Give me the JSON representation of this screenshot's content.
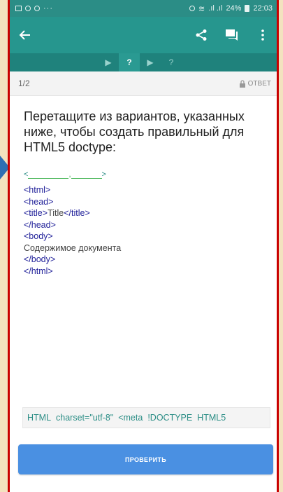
{
  "status": {
    "time": "22:03",
    "battery": "24%",
    "dots": "···"
  },
  "toolbar": {
    "back_icon": "arrow-left-icon",
    "share_icon": "share-icon",
    "comments_icon": "comments-icon",
    "more_icon": "more-vert-icon"
  },
  "progress": {
    "items": [
      "▶",
      "?",
      "▶",
      "?"
    ]
  },
  "subheader": {
    "counter": "1/2",
    "answer_label": "ОТВЕТ"
  },
  "question": {
    "text": "Перетащите из вариантов, указанных ниже, чтобы создать правильный для HTML5 doctype:"
  },
  "code": {
    "blank_open": "<",
    "blank_close": ">",
    "lines": [
      {
        "tag_open": "<html>"
      },
      {
        "tag_open": "<head>"
      },
      {
        "tag_open": "<title>",
        "text": "Title",
        "tag_close": "</title>"
      },
      {
        "tag_open": "</head>"
      },
      {
        "tag_open": "<body>"
      },
      {
        "text": "Содержимое документа"
      },
      {
        "tag_open": "</body>"
      },
      {
        "tag_open": "</html>"
      }
    ]
  },
  "options": [
    "HTML",
    "charset=\"utf-8\"",
    "<meta",
    "!DOCTYPE",
    "HTML5"
  ],
  "check_button": "ПРОВЕРИТЬ",
  "colors": {
    "statusbar": "#2b8d86",
    "toolbar": "#26968e",
    "button": "#4a90e2",
    "border": "#c90000"
  }
}
